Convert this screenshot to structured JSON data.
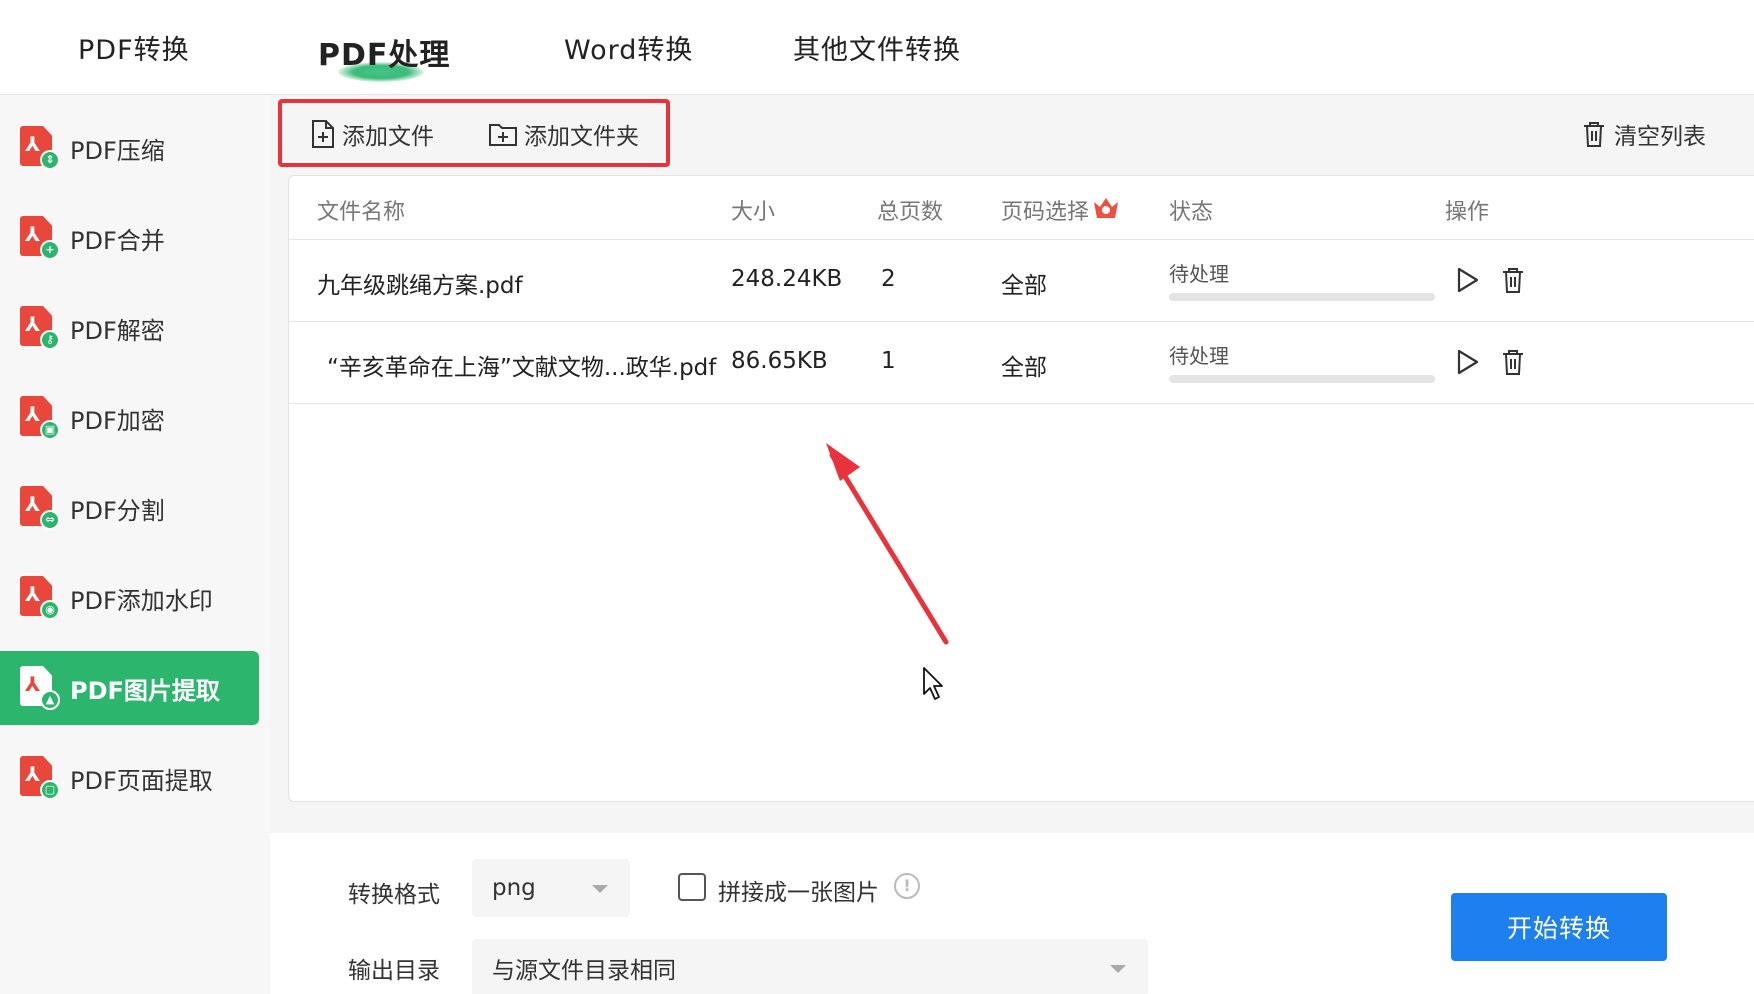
{
  "top_tabs": [
    {
      "label": "PDF转换"
    },
    {
      "label": "PDF处理"
    },
    {
      "label": "Word转换"
    },
    {
      "label": "其他文件转换"
    }
  ],
  "active_tab_index": 1,
  "sidebar": {
    "items": [
      {
        "label": "PDF压缩",
        "badge_icon": "compress-icon"
      },
      {
        "label": "PDF合并",
        "badge_icon": "merge-icon"
      },
      {
        "label": "PDF解密",
        "badge_icon": "key-icon"
      },
      {
        "label": "PDF加密",
        "badge_icon": "lock-icon"
      },
      {
        "label": "PDF分割",
        "badge_icon": "split-icon"
      },
      {
        "label": "PDF添加水印",
        "badge_icon": "watermark-icon"
      },
      {
        "label": "PDF图片提取",
        "badge_icon": "image-icon"
      },
      {
        "label": "PDF页面提取",
        "badge_icon": "page-icon"
      }
    ],
    "active_index": 6
  },
  "toolbar": {
    "add_file_label": "添加文件",
    "add_folder_label": "添加文件夹",
    "clear_list_label": "清空列表"
  },
  "table": {
    "columns": [
      "文件名称",
      "大小",
      "总页数",
      "页码选择",
      "状态",
      "操作"
    ],
    "rows": [
      {
        "name": "九年级跳绳方案.pdf",
        "size": "248.24KB",
        "pages": "2",
        "page_select": "全部",
        "status": "待处理",
        "progress": 0
      },
      {
        "name": "“辛亥革命在上海”文献文物...政华.pdf",
        "size": "86.65KB",
        "pages": "1",
        "page_select": "全部",
        "status": "待处理",
        "progress": 0
      }
    ]
  },
  "bottom": {
    "format_label": "转换格式",
    "format_value": "png",
    "merge_label": "拼接成一张图片",
    "merge_checked": false,
    "output_label": "输出目录",
    "output_value": "与源文件目录相同",
    "start_button_label": "开始转换"
  },
  "colors": {
    "brand_green": "#2cb56c",
    "pdf_red": "#e9473c",
    "highlight_red": "#e8323c",
    "primary_blue": "#1e7ff0"
  }
}
